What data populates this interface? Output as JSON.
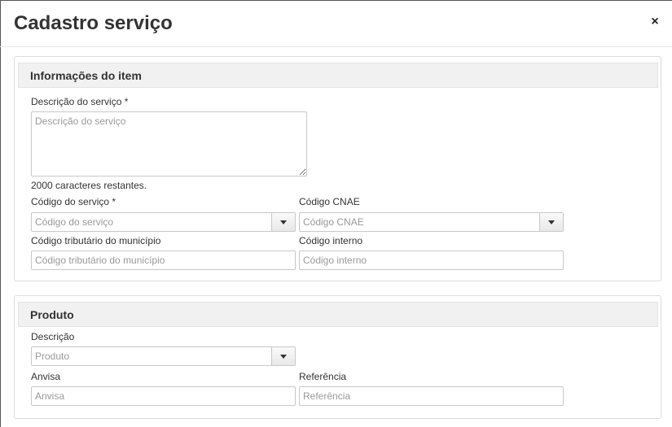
{
  "modal": {
    "title": "Cadastro serviço",
    "close_symbol": "×"
  },
  "item_section": {
    "title": "Informações do item",
    "description": {
      "label": "Descrição do serviço",
      "required_mark": "*",
      "placeholder": "Descrição do serviço",
      "value": "",
      "counter": "2000 caracteres restantes."
    },
    "service_code": {
      "label": "Código do serviço",
      "required_mark": "*",
      "placeholder": "Código do serviço",
      "value": ""
    },
    "cnae_code": {
      "label": "Código CNAE",
      "placeholder": "Código CNAE",
      "value": ""
    },
    "municipal_tax_code": {
      "label": "Código tributário do município",
      "placeholder": "Código tributário do município",
      "value": ""
    },
    "internal_code": {
      "label": "Código interno",
      "placeholder": "Código interno",
      "value": ""
    }
  },
  "product_section": {
    "title": "Produto",
    "description": {
      "label": "Descrição",
      "placeholder": "Produto",
      "value": ""
    },
    "anvisa": {
      "label": "Anvisa",
      "placeholder": "Anvisa",
      "value": ""
    },
    "reference": {
      "label": "Referência",
      "placeholder": "Referência",
      "value": ""
    }
  },
  "icons": {
    "close": "close-icon",
    "dropdown": "chevron-down-icon"
  }
}
